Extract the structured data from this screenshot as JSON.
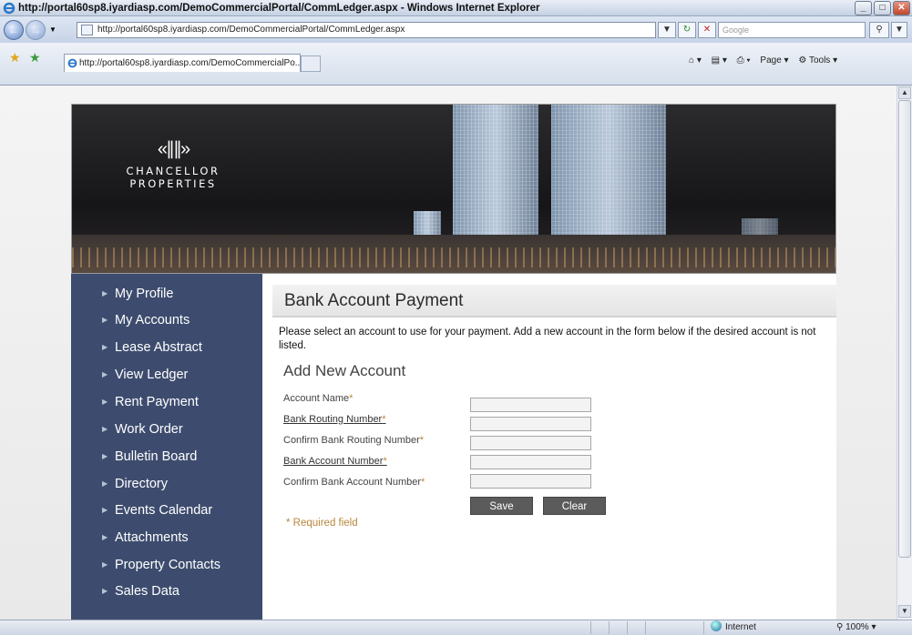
{
  "window": {
    "title": "http://portal60sp8.iyardiasp.com/DemoCommercialPortal/CommLedger.aspx - Windows Internet Explorer"
  },
  "address": {
    "url": "http://portal60sp8.iyardiasp.com/DemoCommercialPortal/CommLedger.aspx",
    "search_placeholder": "Google"
  },
  "tab": {
    "label": "http://portal60sp8.iyardiasp.com/DemoCommercialPo..."
  },
  "command_bar": {
    "page_label": "Page",
    "tools_label": "Tools"
  },
  "logo": {
    "mark": "«∥∥»",
    "line1": "CHANCELLOR",
    "line2": "PROPERTIES"
  },
  "sidebar": {
    "items": [
      {
        "label": "My Profile"
      },
      {
        "label": "My Accounts"
      },
      {
        "label": "Lease Abstract"
      },
      {
        "label": "View Ledger"
      },
      {
        "label": "Rent Payment"
      },
      {
        "label": "Work Order"
      },
      {
        "label": "Bulletin Board"
      },
      {
        "label": "Directory"
      },
      {
        "label": "Events Calendar"
      },
      {
        "label": "Attachments"
      },
      {
        "label": "Property Contacts"
      },
      {
        "label": "Sales Data"
      }
    ]
  },
  "main": {
    "title": "Bank Account Payment",
    "intro": "Please select an account to use for your payment. Add a new account in the form below if the desired account is not listed.",
    "add_heading": "Add New Account",
    "fields": {
      "account_name": {
        "label": "Account Name",
        "required_mark": "*",
        "value": ""
      },
      "routing": {
        "label": "Bank Routing Number",
        "required_mark": "*",
        "value": ""
      },
      "confirm_routing": {
        "label": "Confirm Bank Routing Number",
        "required_mark": "*",
        "value": ""
      },
      "account_number": {
        "label": "Bank Account Number",
        "required_mark": "*",
        "value": ""
      },
      "confirm_account": {
        "label": "Confirm Bank Account Number",
        "required_mark": "*",
        "value": ""
      }
    },
    "save_label": "Save",
    "clear_label": "Clear",
    "required_note": "* Required field"
  },
  "status": {
    "zone": "Internet",
    "zoom": "100%"
  }
}
